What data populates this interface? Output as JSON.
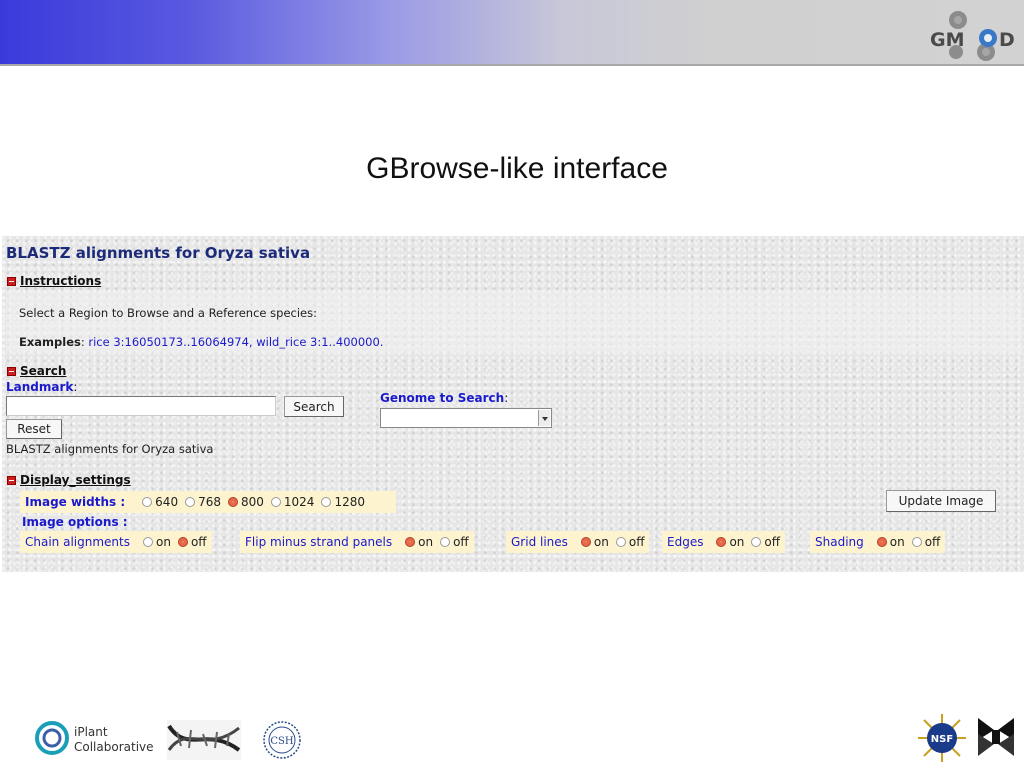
{
  "slide": {
    "title": "GBrowse-like interface",
    "logo_text": "GMOD",
    "footer": {
      "iplant_line1": "iPlant",
      "iplant_line2": "Collaborative",
      "csh_text": "CSH",
      "nsf_text": "NSF"
    }
  },
  "browser": {
    "heading": "BLASTZ alignments for Oryza sativa",
    "instructions": {
      "header": "Instructions",
      "text": "Select a Region to Browse and a Reference species:",
      "examples_label": "Examples",
      "examples_sep": ":",
      "example1": "rice 3:16050173..16064974",
      "example_sep": ",",
      "example2": "wild_rice 3:1..400000."
    },
    "search": {
      "header": "Search",
      "landmark_label": "Landmark",
      "colon": ":",
      "landmark_value": "",
      "search_button": "Search",
      "reset_button": "Reset",
      "genome_label": "Genome to Search",
      "genome_value": "",
      "status_text": "BLASTZ alignments for Oryza sativa"
    },
    "display": {
      "header": "Display_settings",
      "image_widths_label": "Image widths :",
      "widths": [
        "640",
        "768",
        "800",
        "1024",
        "1280"
      ],
      "selected_width": "800",
      "update_button": "Update Image",
      "image_options_label": "Image options :",
      "on": "on",
      "off": "off",
      "options": [
        {
          "label": "Chain alignments",
          "value": "off"
        },
        {
          "label": "Flip minus strand panels",
          "value": "on"
        },
        {
          "label": "Grid lines",
          "value": "on"
        },
        {
          "label": "Edges",
          "value": "on"
        },
        {
          "label": "Shading",
          "value": "on"
        }
      ]
    }
  }
}
